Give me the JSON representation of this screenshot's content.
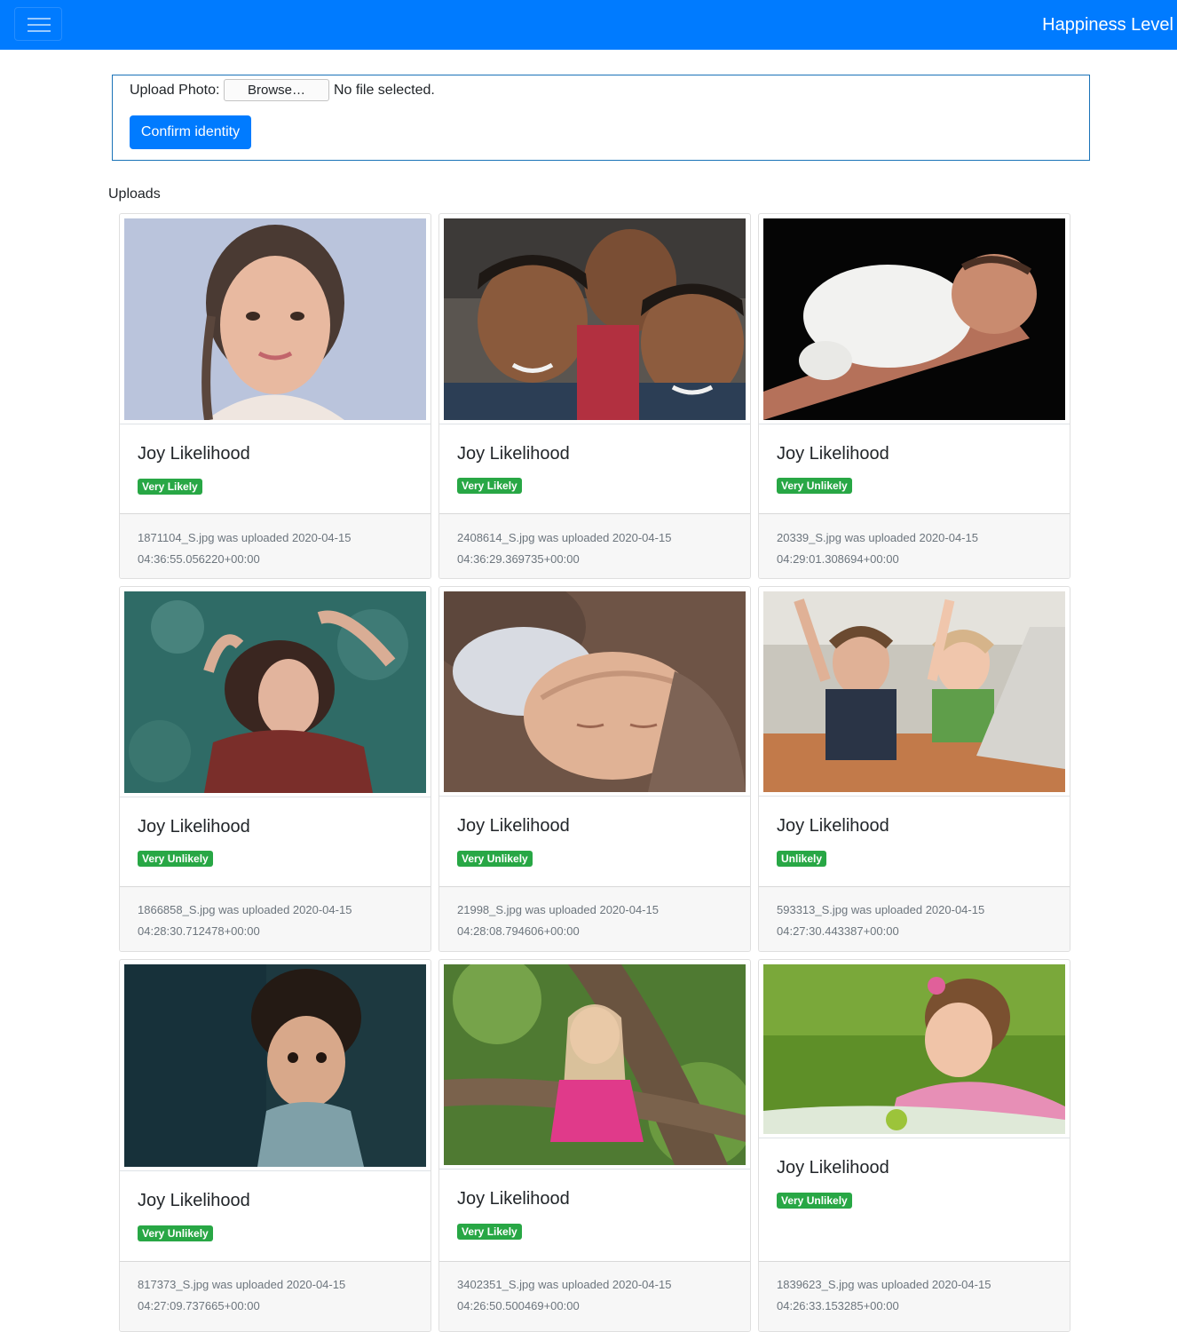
{
  "navbar": {
    "toggler_icon": "hamburger-menu-icon",
    "brand": "Happiness Level",
    "color": "#007bff"
  },
  "upload": {
    "label": "Upload Photo:",
    "browse_label": "Browse…",
    "file_status": "No file selected.",
    "confirm_label": "Confirm identity"
  },
  "uploads_heading": "Uploads",
  "badge_color": "#28a745",
  "cards": [
    {
      "title": "Joy Likelihood",
      "badge": "Very Likely",
      "footer_line1": "1871104_S.jpg was uploaded 2020-04-15",
      "footer_line2": "04:36:55.056220+00:00"
    },
    {
      "title": "Joy Likelihood",
      "badge": "Very Likely",
      "footer_line1": "2408614_S.jpg was uploaded 2020-04-15",
      "footer_line2": "04:36:29.369735+00:00"
    },
    {
      "title": "Joy Likelihood",
      "badge": "Very Unlikely",
      "footer_line1": "20339_S.jpg was uploaded 2020-04-15",
      "footer_line2": "04:29:01.308694+00:00"
    },
    {
      "title": "Joy Likelihood",
      "badge": "Very Unlikely",
      "footer_line1": "1866858_S.jpg was uploaded 2020-04-15",
      "footer_line2": "04:28:30.712478+00:00"
    },
    {
      "title": "Joy Likelihood",
      "badge": "Very Unlikely",
      "footer_line1": "21998_S.jpg was uploaded 2020-04-15",
      "footer_line2": "04:28:08.794606+00:00"
    },
    {
      "title": "Joy Likelihood",
      "badge": "Unlikely",
      "footer_line1": "593313_S.jpg was uploaded 2020-04-15",
      "footer_line2": "04:27:30.443387+00:00"
    },
    {
      "title": "Joy Likelihood",
      "badge": "Very Unlikely",
      "footer_line1": "817373_S.jpg was uploaded 2020-04-15",
      "footer_line2": "04:27:09.737665+00:00"
    },
    {
      "title": "Joy Likelihood",
      "badge": "Very Likely",
      "footer_line1": "3402351_S.jpg was uploaded 2020-04-15",
      "footer_line2": "04:26:50.500469+00:00"
    },
    {
      "title": "Joy Likelihood",
      "badge": "Very Unlikely",
      "footer_line1": "1839623_S.jpg was uploaded 2020-04-15",
      "footer_line2": "04:26:33.153285+00:00"
    }
  ]
}
